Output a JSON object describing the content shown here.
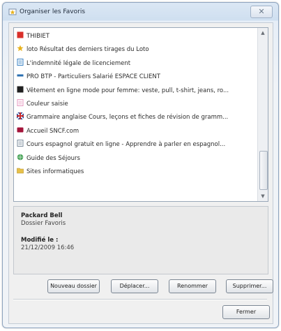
{
  "window": {
    "title": "Organiser les Favoris"
  },
  "list": {
    "items": [
      {
        "label": "THIBIET",
        "icon": "red-square-icon",
        "color": "#d9302a"
      },
      {
        "label": "loto Résultat des derniers tirages du Loto",
        "icon": "star-icon",
        "color": "#e8b21c"
      },
      {
        "label": "L'indemnité légale de licenciement",
        "icon": "page-icon",
        "color": "#3b83c4"
      },
      {
        "label": "PRO BTP - Particuliers Salarié ESPACE CLIENT",
        "icon": "pro-icon",
        "color": "#2a6fb0"
      },
      {
        "label": "Vêtement en ligne mode pour femme: veste, pull, t-shirt, jeans, ro...",
        "icon": "black-square-icon",
        "color": "#202020"
      },
      {
        "label": "Couleur saisie",
        "icon": "pink-page-icon",
        "color": "#e79ac0"
      },
      {
        "label": "Grammaire anglaise Cours, leçons et fiches de révision de gramm...",
        "icon": "flag-icon",
        "color": "#cc2b2b"
      },
      {
        "label": "Accueil SNCF.com",
        "icon": "sncf-icon",
        "color": "#a3143a"
      },
      {
        "label": "Cours espagnol gratuit en ligne - Apprendre à parler en espagnol...",
        "icon": "doc-icon",
        "color": "#7c8c9c"
      },
      {
        "label": "Guide des Séjours",
        "icon": "globe-icon",
        "color": "#4aa35a"
      },
      {
        "label": "Sites informatiques",
        "icon": "folder-icon",
        "color": "#e7c14a"
      }
    ]
  },
  "info": {
    "name": "Packard Bell",
    "type": "Dossier Favoris",
    "modified_label": "Modifié le :",
    "modified_value": "21/12/2009 16:46"
  },
  "buttons": {
    "new_folder": "Nouveau dossier",
    "move": "Déplacer...",
    "rename": "Renommer",
    "delete": "Supprimer...",
    "close": "Fermer"
  }
}
